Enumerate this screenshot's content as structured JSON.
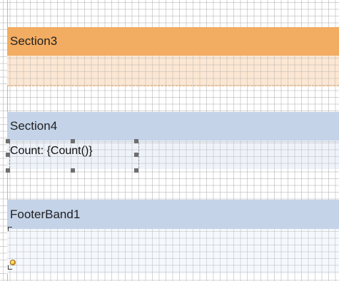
{
  "bands": [
    {
      "header": "Section3",
      "color": "#f2ad62"
    },
    {
      "header": "Section4",
      "color": "#c4d3e8"
    },
    {
      "header": "FooterBand1",
      "color": "#c4d3e8"
    }
  ],
  "textbox": {
    "text": "Count: {Count()}"
  },
  "icons": {
    "event": "event-icon",
    "handle": "resize-handle"
  }
}
